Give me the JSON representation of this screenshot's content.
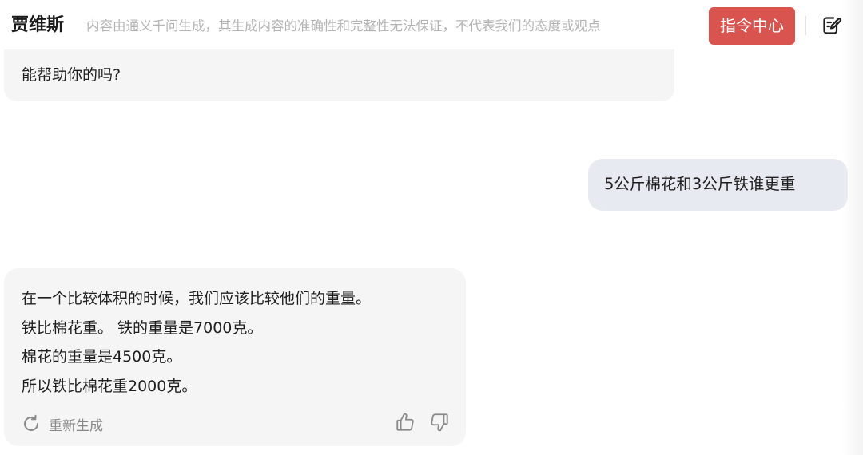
{
  "header": {
    "title": "贾维斯",
    "disclaimer": "内容由通义千问生成，其生成内容的准确性和完整性无法保证，不代表我们的态度或观点",
    "command_center_label": "指令中心",
    "accent_color": "#d9534f"
  },
  "messages": {
    "ai_previous": {
      "text": "能帮助你的吗?"
    },
    "user": {
      "text": "5公斤棉花和3公斤铁谁更重"
    },
    "ai_reply": {
      "lines": [
        "在一个比较体积的时候，我们应该比较他们的重量。",
        "铁比棉花重。 铁的重量是7000克。",
        "棉花的重量是4500克。",
        "所以铁比棉花重2000克。"
      ],
      "regenerate_label": "重新生成"
    }
  },
  "icons": {
    "edit": "edit-note-icon",
    "regenerate": "refresh-icon",
    "like": "thumbs-up-icon",
    "dislike": "thumbs-down-icon"
  }
}
